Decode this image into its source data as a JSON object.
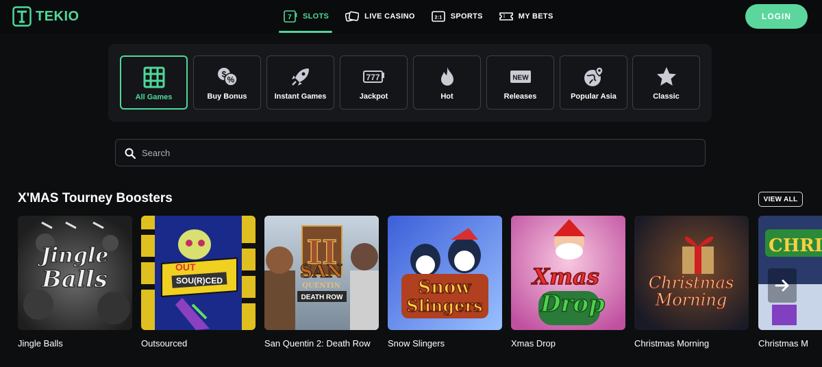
{
  "brand": {
    "name": "TEKIO",
    "color": "#4fd99a"
  },
  "nav": [
    {
      "label": "SLOTS",
      "icon": "slot-machine-icon",
      "active": true
    },
    {
      "label": "LIVE CASINO",
      "icon": "cards-icon",
      "active": false
    },
    {
      "label": "SPORTS",
      "icon": "scoreboard-icon",
      "active": false
    },
    {
      "label": "MY BETS",
      "icon": "ticket-icon",
      "active": false
    }
  ],
  "login_label": "LOGIN",
  "categories": [
    {
      "label": "All Games",
      "icon": "grid-icon",
      "active": true
    },
    {
      "label": "Buy Bonus",
      "icon": "coins-percent-icon",
      "active": false
    },
    {
      "label": "Instant Games",
      "icon": "rocket-icon",
      "active": false
    },
    {
      "label": "Jackpot",
      "icon": "777-icon",
      "active": false
    },
    {
      "label": "Hot",
      "icon": "flame-icon",
      "active": false
    },
    {
      "label": "Releases",
      "icon": "new-badge-icon",
      "active": false
    },
    {
      "label": "Popular Asia",
      "icon": "globe-pin-icon",
      "active": false
    },
    {
      "label": "Classic",
      "icon": "star-icon",
      "active": false
    }
  ],
  "search": {
    "placeholder": "Search"
  },
  "section": {
    "title": "X'MAS Tourney Boosters",
    "view_all": "VIEW ALL",
    "games": [
      {
        "name": "Jingle Balls",
        "thumb_text": "Jingle Balls"
      },
      {
        "name": "Outsourced",
        "thumb_text": "OUT SOURCED"
      },
      {
        "name": "San Quentin 2: Death Row",
        "thumb_text": "SAN QUENTIN DEATH ROW"
      },
      {
        "name": "Snow Slingers",
        "thumb_text": "Snow Slingers"
      },
      {
        "name": "Xmas Drop",
        "thumb_text": "Xmas Drop"
      },
      {
        "name": "Christmas Morning",
        "thumb_text": "Christmas Morning"
      },
      {
        "name": "Christmas M",
        "thumb_text": "CHRI"
      }
    ]
  },
  "colors": {
    "accent": "#4fd99a",
    "background": "#0d0e10",
    "panel": "#17181b",
    "border": "#3a3f49"
  }
}
